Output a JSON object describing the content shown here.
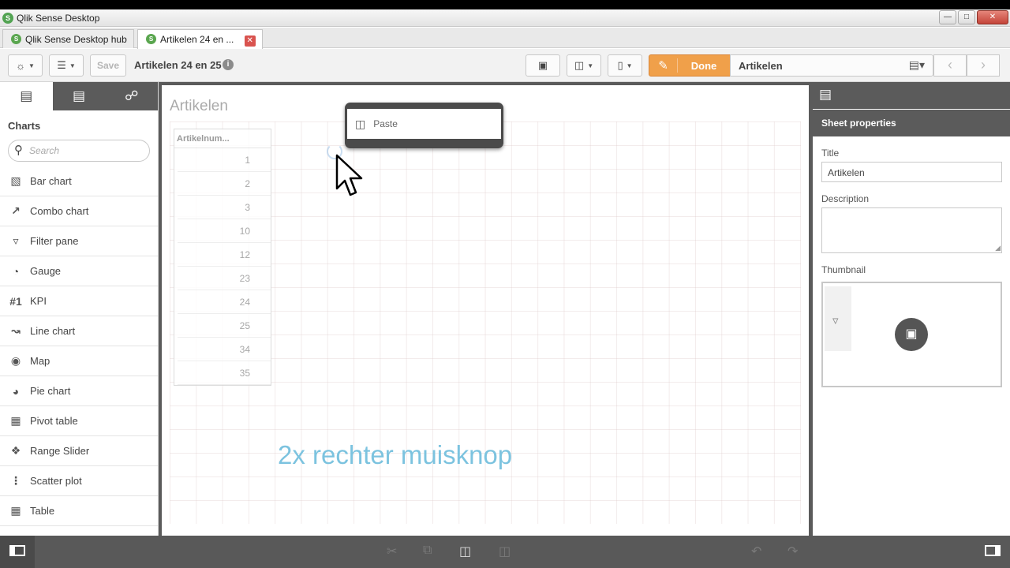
{
  "window": {
    "title": "Qlik Sense Desktop",
    "icon": "qlik-app-icon",
    "controls": [
      "minimize",
      "maximize",
      "close"
    ]
  },
  "tabs": [
    {
      "label": "Qlik Sense Desktop hub",
      "active": false
    },
    {
      "label": "Artikelen 24 en ...",
      "active": true,
      "closable": true
    }
  ],
  "toolbar": {
    "navigation_icon": "compass-icon",
    "menu_icon": "list-icon",
    "save_label": "Save",
    "app_name": "Artikelen 24 en 25",
    "info_icon": "info-icon",
    "snapshot_icon": "camera-icon",
    "present_icon": "presentation-icon",
    "bookmark_icon": "bookmark-icon",
    "done_label": "Done",
    "current_sheet": "Artikelen",
    "sheets_icon": "sheets-icon",
    "accent_color": "#f0a04a"
  },
  "assets_panel": {
    "tabs": [
      "charts-tab",
      "fields-tab",
      "master-items-tab"
    ],
    "heading": "Charts",
    "search_placeholder": "Search",
    "items": [
      {
        "label": "Bar chart",
        "icon": "bar-chart-icon"
      },
      {
        "label": "Combo chart",
        "icon": "combo-chart-icon"
      },
      {
        "label": "Filter pane",
        "icon": "filter-pane-icon"
      },
      {
        "label": "Gauge",
        "icon": "gauge-icon"
      },
      {
        "label": "KPI",
        "icon": "kpi-icon"
      },
      {
        "label": "Line chart",
        "icon": "line-chart-icon"
      },
      {
        "label": "Map",
        "icon": "map-icon"
      },
      {
        "label": "Pie chart",
        "icon": "pie-chart-icon"
      },
      {
        "label": "Pivot table",
        "icon": "pivot-table-icon"
      },
      {
        "label": "Range Slider",
        "icon": "range-slider-icon"
      },
      {
        "label": "Scatter plot",
        "icon": "scatter-plot-icon"
      },
      {
        "label": "Table",
        "icon": "table-icon"
      }
    ]
  },
  "sheet": {
    "title": "Artikelen",
    "table": {
      "header": "Artikelnum...",
      "rows": [
        "1",
        "2",
        "3",
        "10",
        "12",
        "23",
        "24",
        "25",
        "34",
        "35"
      ]
    },
    "annotation": "2x rechter muisknop"
  },
  "context_menu": {
    "items": [
      {
        "label": "Paste",
        "icon": "paste-icon"
      }
    ]
  },
  "properties_panel": {
    "header": "Sheet properties",
    "title_label": "Title",
    "title_value": "Artikelen",
    "description_label": "Description",
    "description_value": "",
    "thumbnail_label": "Thumbnail",
    "thumbnail_icon": "image-icon"
  },
  "bottom_bar": {
    "icons": [
      "cut-icon",
      "copy-icon",
      "paste-icon",
      "delete-icon",
      "undo-icon",
      "redo-icon"
    ]
  }
}
